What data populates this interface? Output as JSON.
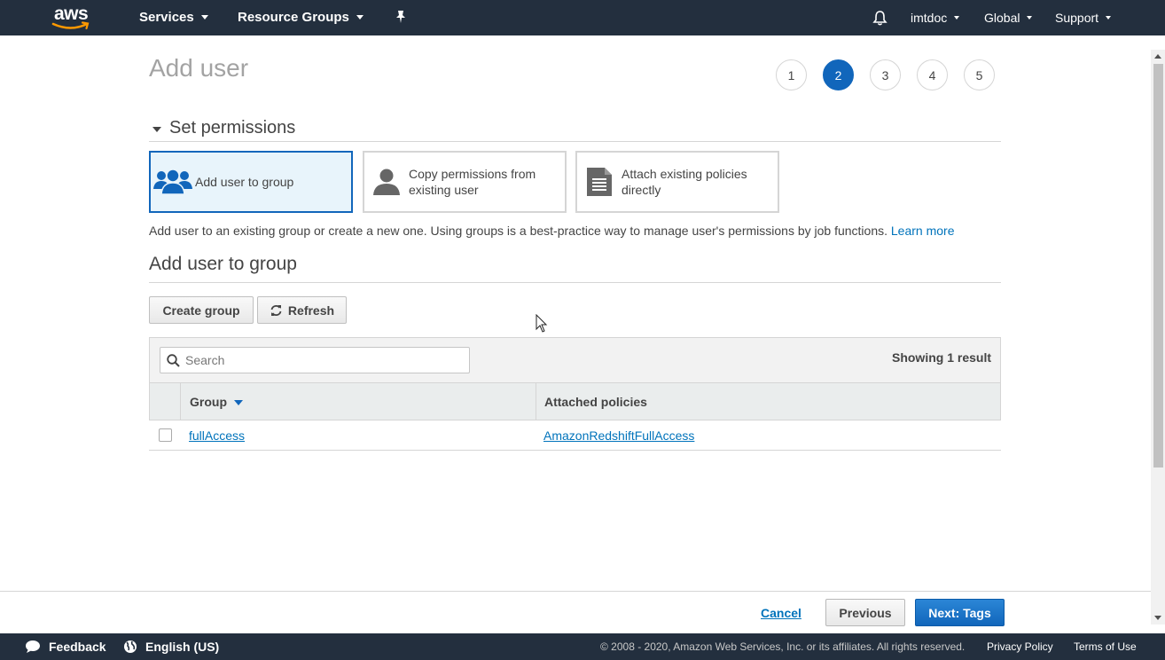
{
  "topnav": {
    "logo_text": "aws",
    "services": "Services",
    "resource_groups": "Resource Groups",
    "account": "imtdoc",
    "region": "Global",
    "support": "Support"
  },
  "page": {
    "title": "Add user",
    "steps": [
      "1",
      "2",
      "3",
      "4",
      "5"
    ],
    "active_step": "2"
  },
  "permissions": {
    "section_title": "Set permissions",
    "options": [
      {
        "label": "Add user to group",
        "icon": "users-group-icon",
        "selected": true
      },
      {
        "label": "Copy permissions from existing user",
        "icon": "user-icon",
        "selected": false
      },
      {
        "label": "Attach existing policies directly",
        "icon": "document-icon",
        "selected": false
      }
    ],
    "description": "Add user to an existing group or create a new one. Using groups is a best-practice way to manage user's permissions by job functions.",
    "learn_more": "Learn more"
  },
  "group_section": {
    "title": "Add user to group",
    "create_group": "Create group",
    "refresh": "Refresh",
    "search_placeholder": "Search",
    "showing": "Showing 1 result",
    "columns": [
      "Group",
      "Attached policies"
    ],
    "rows": [
      {
        "group": "fullAccess",
        "policies": "AmazonRedshiftFullAccess"
      }
    ]
  },
  "actions": {
    "cancel": "Cancel",
    "previous": "Previous",
    "next": "Next: Tags"
  },
  "footer": {
    "feedback": "Feedback",
    "language": "English (US)",
    "copyright": "© 2008 - 2020, Amazon Web Services, Inc. or its affiliates. All rights reserved.",
    "privacy": "Privacy Policy",
    "terms": "Terms of Use"
  },
  "colors": {
    "nav_bg": "#232f3e",
    "accent": "#1166bb",
    "link": "#0073bb",
    "aws_orange": "#ff9900"
  }
}
